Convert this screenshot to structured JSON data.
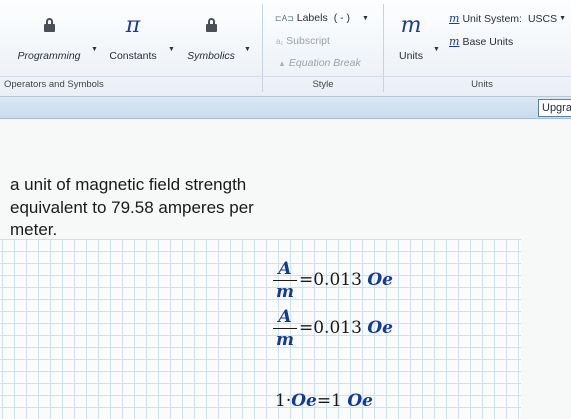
{
  "ribbon": {
    "programming_label": "Programming",
    "constants_label": "Constants",
    "symbolics_label": "Symbolics",
    "operators_group_label": "Operators and Symbols",
    "labels_label": "Labels",
    "labels_value": "( - )",
    "subscript_label": "Subscript",
    "equation_break_label": "Equation Break",
    "style_group_label": "Style",
    "units_label": "Units",
    "unit_system_label": "Unit System:",
    "unit_system_value": "USCS",
    "base_units_label": "Base Units",
    "units_group_label": "Units",
    "pi_symbol": "π",
    "units_symbol": "m"
  },
  "strip": {
    "upgrade_label": "Upgrade"
  },
  "worksheet": {
    "text_region": "a unit of magnetic field strength equivalent to 79.58 amperes per meter.",
    "eq1": {
      "num": "A",
      "den": "m",
      "result": "=0.013",
      "unit": "Oe"
    },
    "eq2": {
      "num": "A",
      "den": "m",
      "result": "=0.013",
      "unit": "Oe"
    },
    "eq3": {
      "lhs_num": "1",
      "dot": "·",
      "lhs_unit": "Oe",
      "result": "=1",
      "unit": "Oe"
    }
  }
}
